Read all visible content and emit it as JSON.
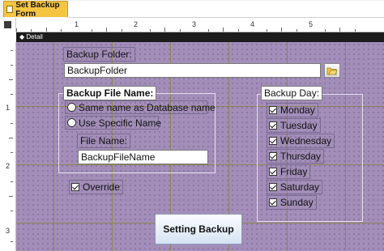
{
  "tab": {
    "title": "Set Backup Form"
  },
  "section": {
    "label": "Detail"
  },
  "ruler": {
    "horizontal": [
      "1",
      "2",
      "3",
      "4",
      "5"
    ],
    "vertical": [
      "1",
      "2",
      "3"
    ]
  },
  "form": {
    "backup_folder_label": "Backup Folder:",
    "backup_folder_value": "BackupFolder",
    "backup_file_name_label": "Backup File Name:",
    "option_same_name": "Same name as Database name",
    "option_specific_name": "Use Specific Name",
    "file_name_label": "File Name:",
    "file_name_value": "BackupFileName",
    "override_label": "Override",
    "backup_day_label": "Backup Day:",
    "days": [
      "Monday",
      "Tuesday",
      "Wednesday",
      "Thursday",
      "Friday",
      "Saturday",
      "Sunday"
    ],
    "setting_backup_button": "Setting Backup"
  },
  "colors": {
    "canvas": "#a28eb8",
    "tab": "#f5c542",
    "section_bar": "#1c1c1c"
  }
}
